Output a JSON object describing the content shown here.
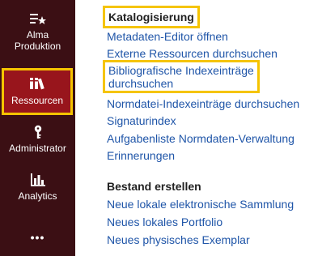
{
  "sidebar": {
    "items": [
      {
        "label_line1": "Alma",
        "label_line2": "Produktion",
        "icon": "list-star-icon"
      },
      {
        "label": "Ressourcen",
        "icon": "books-icon",
        "active": true
      },
      {
        "label": "Administrator",
        "icon": "key-icon"
      },
      {
        "label": "Analytics",
        "icon": "bar-chart-icon"
      },
      {
        "label": "•••",
        "icon": "more-icon"
      }
    ]
  },
  "main": {
    "sections": [
      {
        "heading": "Katalogisierung",
        "links": [
          "Metadaten-Editor öffnen",
          "Externe Ressourcen durchsuchen",
          "Bibliografische Indexeinträge",
          "durchsuchen",
          "Normdatei-Indexeinträge durchsuchen",
          "Signaturindex",
          "Aufgabenliste Normdaten-Verwaltung",
          "Erinnerungen"
        ]
      },
      {
        "heading": "Bestand erstellen",
        "links": [
          "Neue lokale elektronische Sammlung",
          "Neues lokales Portfolio",
          "Neues physisches Exemplar"
        ]
      }
    ]
  },
  "colors": {
    "sidebar_bg": "#3b0f14",
    "active_bg": "#98151c",
    "highlight": "#f5c400",
    "link": "#1f55a8"
  }
}
